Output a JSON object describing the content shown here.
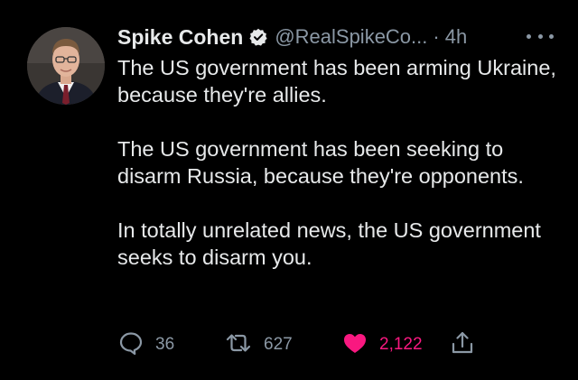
{
  "user": {
    "name": "Spike Cohen",
    "handle": "@RealSpikeCo...",
    "separator": "·",
    "time": "4h",
    "verified": true,
    "avatar": "profile-photo"
  },
  "tweet": {
    "paragraphs": [
      "The US government has been arming Ukraine, because they're allies.",
      "The US government has been seeking to disarm Russia, because they're opponents.",
      "In totally unrelated news, the US government seeks to disarm you."
    ]
  },
  "actions": {
    "reply": {
      "icon": "reply-icon",
      "count": "36"
    },
    "retweet": {
      "icon": "retweet-icon",
      "count": "627"
    },
    "like": {
      "icon": "heart-icon",
      "count": "2,122",
      "liked": true
    },
    "share": {
      "icon": "share-icon"
    }
  },
  "colors": {
    "background": "#000000",
    "text": "#e7e9ea",
    "secondary": "#8b98a5",
    "like": "#f91880"
  }
}
